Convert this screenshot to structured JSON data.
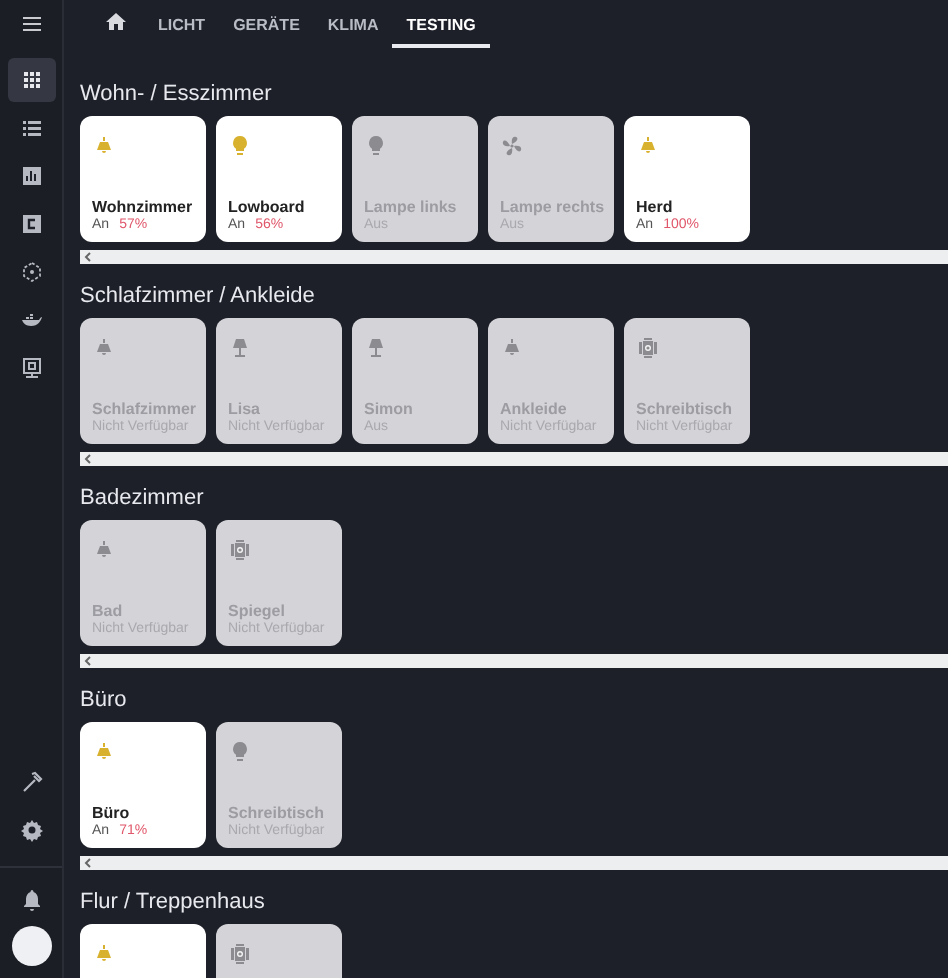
{
  "sidebar": {
    "items": [
      {
        "kind": "grid",
        "selected": true
      },
      {
        "kind": "list",
        "selected": false
      },
      {
        "kind": "chart",
        "selected": false
      },
      {
        "kind": "cbox",
        "selected": false
      },
      {
        "kind": "network",
        "selected": false
      },
      {
        "kind": "whale",
        "selected": false
      },
      {
        "kind": "board",
        "selected": false
      }
    ],
    "bottom_items": [
      {
        "kind": "hammer",
        "selected": false
      },
      {
        "kind": "gear",
        "selected": false
      }
    ]
  },
  "tabs": [
    {
      "kind": "home",
      "selected": false
    },
    {
      "label": "LICHT",
      "selected": false
    },
    {
      "label": "GERÄTE",
      "selected": false
    },
    {
      "label": "KLIMA",
      "selected": false
    },
    {
      "label": "TESTING",
      "selected": true
    }
  ],
  "sections": [
    {
      "title": "Wohn- / Esszimmer",
      "scrollbar": true,
      "cards": [
        {
          "kind": "bell",
          "name": "Wohnzimmer",
          "status": "An",
          "brightness": "57%",
          "on": true
        },
        {
          "kind": "bulb",
          "name": "Lowboard",
          "status": "An",
          "brightness": "56%",
          "on": true
        },
        {
          "kind": "bulb",
          "name": "Lampe links",
          "status": "Aus",
          "on": false
        },
        {
          "kind": "fan",
          "name": "Lampe rechts",
          "status": "Aus",
          "on": false
        },
        {
          "kind": "bell",
          "name": "Herd",
          "status": "An",
          "brightness": "100%",
          "on": true
        }
      ]
    },
    {
      "title": "Schlafzimmer / Ankleide",
      "scrollbar": true,
      "cards": [
        {
          "kind": "bell",
          "name": "Schlafzimmer",
          "status": "Nicht Verfügbar",
          "on": false
        },
        {
          "kind": "lamp",
          "name": "Lisa",
          "status": "Nicht Verfügbar",
          "on": false
        },
        {
          "kind": "lamp",
          "name": "Simon",
          "status": "Aus",
          "on": false
        },
        {
          "kind": "bell",
          "name": "Ankleide",
          "status": "Nicht Verfügbar",
          "on": false
        },
        {
          "kind": "spot",
          "name": "Schreibtisch",
          "status": "Nicht Verfügbar",
          "on": false
        }
      ]
    },
    {
      "title": "Badezimmer",
      "scrollbar": true,
      "cards": [
        {
          "kind": "bell",
          "name": "Bad",
          "status": "Nicht Verfügbar",
          "on": false
        },
        {
          "kind": "spot",
          "name": "Spiegel",
          "status": "Nicht Verfügbar",
          "on": false
        }
      ]
    },
    {
      "title": "Büro",
      "scrollbar": true,
      "cards": [
        {
          "kind": "bell",
          "name": "Büro",
          "status": "An",
          "brightness": "71%",
          "on": true
        },
        {
          "kind": "bulb",
          "name": "Schreibtisch",
          "status": "Nicht Verfügbar",
          "on": false
        }
      ]
    },
    {
      "title": "Flur / Treppenhaus",
      "scrollbar": false,
      "cards": [
        {
          "kind": "bell",
          "on": true
        },
        {
          "kind": "spot",
          "on": false
        }
      ]
    }
  ]
}
